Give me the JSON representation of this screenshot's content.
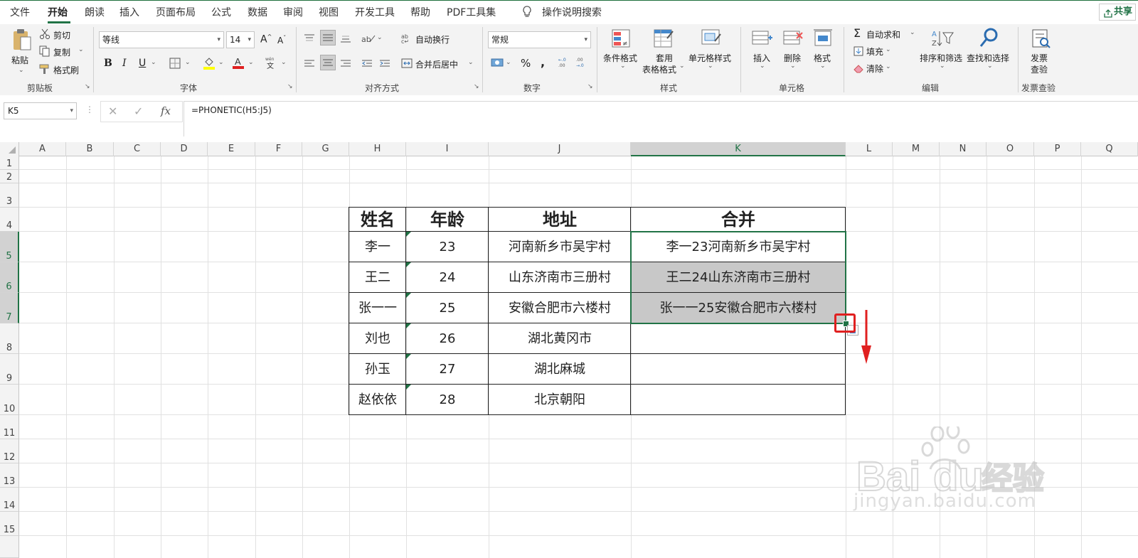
{
  "menu": {
    "items": [
      "文件",
      "开始",
      "朗读",
      "插入",
      "页面布局",
      "公式",
      "数据",
      "审阅",
      "视图",
      "开发工具",
      "帮助",
      "PDF工具集"
    ],
    "search": "操作说明搜索",
    "share": "共享"
  },
  "ribbon": {
    "clipboard": {
      "paste": "粘贴",
      "cut": "剪切",
      "copy": "复制",
      "format_painter": "格式刷",
      "label": "剪贴板"
    },
    "font": {
      "name": "等线",
      "size": "14",
      "label": "字体",
      "bold": "B",
      "italic": "I",
      "underline": "U"
    },
    "alignment": {
      "wrap": "自动换行",
      "merge": "合并后居中",
      "label": "对齐方式"
    },
    "number": {
      "format": "常规",
      "label": "数字",
      "percent": "%",
      "comma": ","
    },
    "styles": {
      "conditional": "条件格式",
      "table_line1": "套用",
      "table_line2": "表格格式",
      "cell_styles": "单元格样式",
      "label": "样式"
    },
    "cells": {
      "insert": "插入",
      "delete": "删除",
      "format": "格式",
      "label": "单元格"
    },
    "editing": {
      "autosum": "自动求和",
      "fill": "填充",
      "clear": "清除",
      "sort": "排序和筛选",
      "find": "查找和选择",
      "label": "编辑"
    },
    "invoice": {
      "line1": "发票",
      "line2": "查验",
      "label": "发票查验"
    }
  },
  "formula_bar": {
    "name_box": "K5",
    "formula": "=PHONETIC(H5:J5)",
    "fx": "fx"
  },
  "columns": [
    "A",
    "B",
    "C",
    "D",
    "E",
    "F",
    "G",
    "H",
    "I",
    "J",
    "K",
    "L",
    "M",
    "N",
    "O",
    "P",
    "Q"
  ],
  "rows": [
    "1",
    "2",
    "3",
    "4",
    "5",
    "6",
    "7",
    "8",
    "9",
    "10",
    "11",
    "12",
    "13",
    "14",
    "15"
  ],
  "table": {
    "headers": [
      "姓名",
      "年龄",
      "地址",
      "合并"
    ],
    "rows": [
      {
        "name": "李一",
        "age": "23",
        "address": "河南新乡市吴宇村",
        "merged": "李一23河南新乡市吴宇村"
      },
      {
        "name": "王二",
        "age": "24",
        "address": "山东济南市三册村",
        "merged": "王二24山东济南市三册村"
      },
      {
        "name": "张一一",
        "age": "25",
        "address": "安徽合肥市六楼村",
        "merged": "张一一25安徽合肥市六楼村"
      },
      {
        "name": "刘也",
        "age": "26",
        "address": "湖北黄冈市",
        "merged": ""
      },
      {
        "name": "孙玉",
        "age": "27",
        "address": "湖北麻城",
        "merged": ""
      },
      {
        "name": "赵依依",
        "age": "28",
        "address": "北京朝阳",
        "merged": ""
      }
    ]
  },
  "watermark": {
    "logo": "Baidu经验",
    "url": "jingyan.baidu.com"
  },
  "colors": {
    "excel_green": "#217346",
    "selection_grey": "#c8c8c8",
    "annotation_red": "#e02020"
  }
}
